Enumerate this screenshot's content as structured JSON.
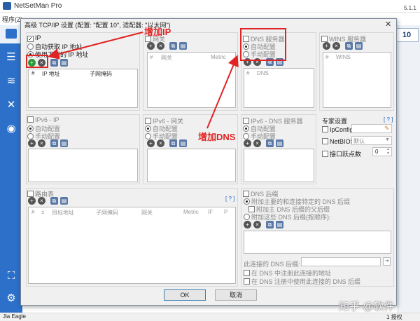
{
  "app": {
    "title": "NetSetMan Pro",
    "version": "5.1.1",
    "menu": "程序(Z)",
    "right_button": "10",
    "status_user": "Jia Eagle",
    "status_right": "1 授权",
    "watermark": "知乎 @软件"
  },
  "dialog": {
    "title": "高级 TCP/IP 设置 (配置: \"配置 10\", 适配器: \"以太网\")",
    "close": "✕",
    "ip": {
      "title": "IP",
      "auto": "自动获取 IP 地址",
      "manual": "使用下面的 IP 地址",
      "cols": [
        "#",
        "IP 地址",
        "子网掩码"
      ]
    },
    "gateway": {
      "title": "网关",
      "cols": [
        "#",
        "网关",
        "Metric"
      ]
    },
    "dns": {
      "title": "DNS 服务器",
      "auto": "自动配置",
      "manual": "手动配置",
      "cols": [
        "#",
        "DNS"
      ]
    },
    "wins": {
      "title": "WINS 服务器",
      "cols": [
        "#",
        "WINS"
      ]
    },
    "ipv6": {
      "title": "IPv6 - IP",
      "auto": "自动配置",
      "manual": "手动配置"
    },
    "ipv6_gw": {
      "title": "IPv6 - 网关",
      "auto": "自动配置",
      "manual": "手动配置"
    },
    "ipv6_dns": {
      "title": "IPv6 - DNS 服务器",
      "auto": "自动配置",
      "manual": "手动配置"
    },
    "expert": {
      "title": "专家设置",
      "help": "[ ? ]",
      "ipconfig": "IpConfig",
      "netbios": "NetBIOS",
      "netbios_value": "默认",
      "metric": "接口跃点数",
      "metric_value": "0"
    },
    "routes": {
      "title": "路由表",
      "help": "[ ? ]",
      "cols": [
        "#",
        "±",
        "目标地址",
        "子网掩码",
        "网关",
        "Metric",
        "IF",
        "P"
      ]
    },
    "dns_suffix": {
      "title": "DNS 后缀",
      "opt1": "附加主要的和连接特定的 DNS 后缀",
      "opt1_sub": "附加主 DNS 后缀的父后缀",
      "opt2": "附加这些 DNS 后缀(按顺序):",
      "conn_label": "此连接的 DNS 后缀:",
      "register": "在 DNS 中注册此连接的地址",
      "register_suffix": "在 DNS 注册中使用此连接的 DNS 后缀"
    },
    "ok": "OK",
    "cancel": "取消"
  },
  "annotations": {
    "add_ip": "增加IP",
    "add_dns": "增加DNS"
  },
  "colors": {
    "sidebar": "#2d70c9",
    "annotation": "#e02323",
    "add_icon": "#2a9a3a"
  }
}
